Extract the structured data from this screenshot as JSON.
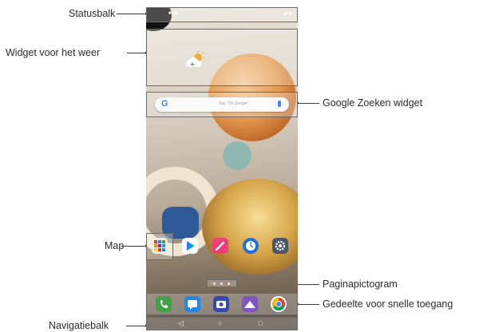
{
  "labels": {
    "statusbar": "Statusbalk",
    "weather_widget": "Widget voor het weer",
    "map": "Map",
    "navbar": "Navigatiebalk",
    "google_search_widget": "Google Zoeken widget",
    "page_icon": "Paginapictogram",
    "quick_access": "Gedeelte voor snelle toegang"
  },
  "phone": {
    "search_hint": "Say \"Ok Google\"",
    "google_letter": "G",
    "nav_back": "◁",
    "nav_home": "○",
    "nav_recent": "□"
  },
  "icons": {
    "weather": "partly-cloudy-icon",
    "folder": "folder-icon",
    "play_store": "play-store-icon",
    "pen": "pen-icon",
    "clock": "clock-icon",
    "settings": "gear-icon",
    "phone": "phone-icon",
    "messages": "messages-icon",
    "camera": "camera-icon",
    "gallery": "gallery-icon",
    "chrome": "chrome-icon"
  },
  "colors": {
    "leader_line": "#3a3a3a",
    "highlight_border": "#6a6a6a"
  }
}
